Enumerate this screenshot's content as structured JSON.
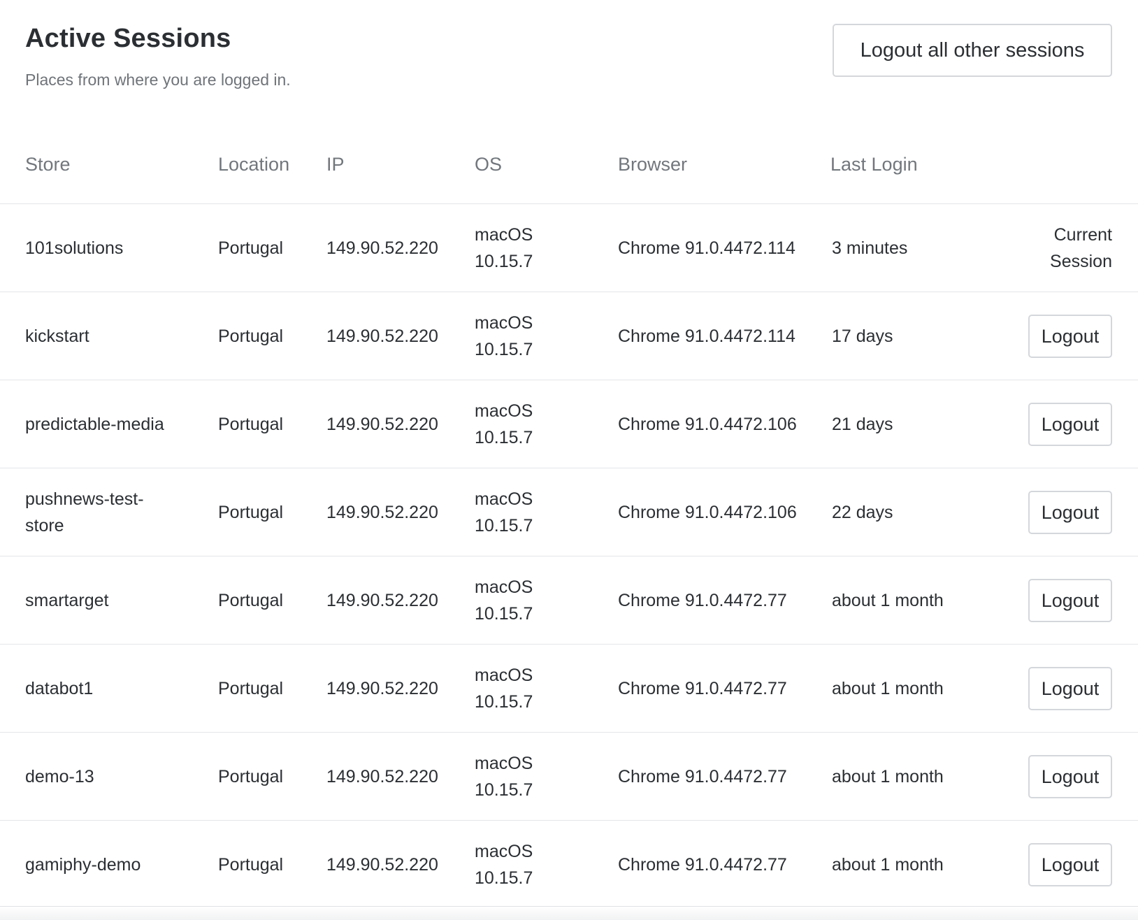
{
  "header": {
    "title": "Active Sessions",
    "subtitle": "Places from where you are logged in.",
    "logout_all_label": "Logout all other sessions"
  },
  "table": {
    "columns": {
      "store": "Store",
      "location": "Location",
      "ip": "IP",
      "os": "OS",
      "browser": "Browser",
      "last_login": "Last Login"
    },
    "rows": [
      {
        "store": "101solutions",
        "location": "Portugal",
        "ip": "149.90.52.220",
        "os_name": "macOS",
        "os_version": "10.15.7",
        "browser": "Chrome 91.0.4472.114",
        "last_login": "3 minutes",
        "current_line1": "Current",
        "current_line2": "Session"
      },
      {
        "store": "kickstart",
        "location": "Portugal",
        "ip": "149.90.52.220",
        "os_name": "macOS",
        "os_version": "10.15.7",
        "browser": "Chrome 91.0.4472.114",
        "last_login": "17 days",
        "action_label": "Logout"
      },
      {
        "store": "predictable-media",
        "location": "Portugal",
        "ip": "149.90.52.220",
        "os_name": "macOS",
        "os_version": "10.15.7",
        "browser": "Chrome 91.0.4472.106",
        "last_login": "21 days",
        "action_label": "Logout"
      },
      {
        "store": "pushnews-test-store",
        "location": "Portugal",
        "ip": "149.90.52.220",
        "os_name": "macOS",
        "os_version": "10.15.7",
        "browser": "Chrome 91.0.4472.106",
        "last_login": "22 days",
        "action_label": "Logout"
      },
      {
        "store": "smartarget",
        "location": "Portugal",
        "ip": "149.90.52.220",
        "os_name": "macOS",
        "os_version": "10.15.7",
        "browser": "Chrome 91.0.4472.77",
        "last_login": "about 1 month",
        "action_label": "Logout"
      },
      {
        "store": "databot1",
        "location": "Portugal",
        "ip": "149.90.52.220",
        "os_name": "macOS",
        "os_version": "10.15.7",
        "browser": "Chrome 91.0.4472.77",
        "last_login": "about 1 month",
        "action_label": "Logout"
      },
      {
        "store": "demo-13",
        "location": "Portugal",
        "ip": "149.90.52.220",
        "os_name": "macOS",
        "os_version": "10.15.7",
        "browser": "Chrome 91.0.4472.77",
        "last_login": "about 1 month",
        "action_label": "Logout"
      },
      {
        "store": "gamiphy-demo",
        "location": "Portugal",
        "ip": "149.90.52.220",
        "os_name": "macOS",
        "os_version": "10.15.7",
        "browser": "Chrome 91.0.4472.77",
        "last_login": "about 1 month",
        "action_label": "Logout"
      }
    ]
  }
}
